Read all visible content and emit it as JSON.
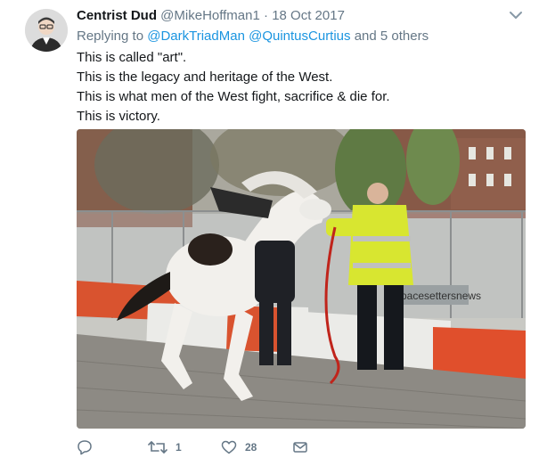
{
  "tweet": {
    "display_name": "Centrist Dud",
    "handle": "@MikeHoffman1",
    "separator": "·",
    "date": "18 Oct 2017",
    "reply": {
      "prefix": "Replying to",
      "mention1": "@DarkTriadMan",
      "mention2": "@QuintusCurtius",
      "suffix": "and 5 others"
    },
    "text_lines": [
      "This is called \"art\".",
      "This is the legacy and heritage of the West.",
      "This is what men of the West fight, sacrifice & die for.",
      "This is victory."
    ],
    "media": {
      "description_icon": "photo",
      "sign_text": "pacesettersnews"
    },
    "actions": {
      "reply_icon": "reply-icon",
      "retweet_icon": "retweet-icon",
      "retweet_count": "1",
      "like_icon": "heart-icon",
      "like_count": "28",
      "dm_icon": "envelope-icon"
    }
  },
  "colors": {
    "link": "#1b95e0",
    "secondary_text": "#657786",
    "primary_text": "#14171a"
  }
}
